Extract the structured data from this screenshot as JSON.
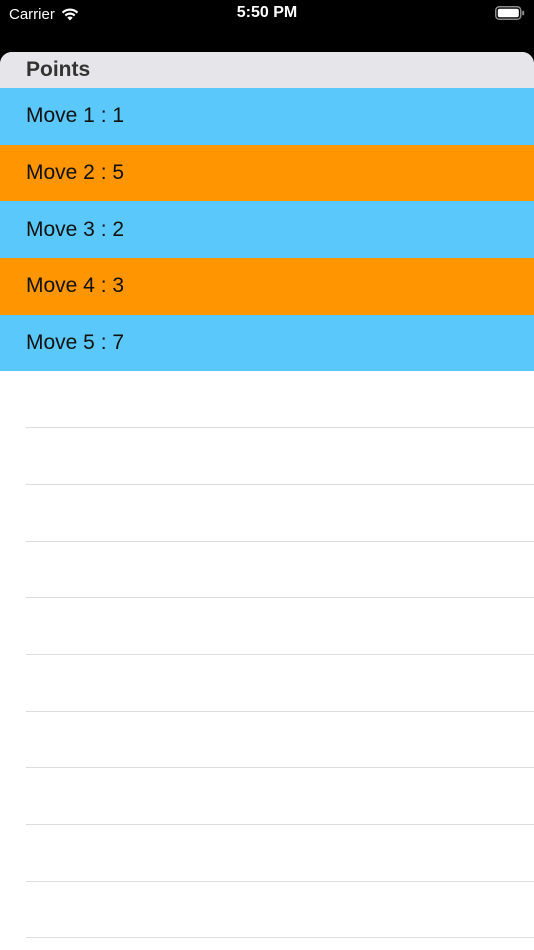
{
  "status_bar": {
    "carrier": "Carrier",
    "time": "5:50 PM"
  },
  "table": {
    "section_title": "Points",
    "row_colors": [
      "#5ac8fa",
      "#ff9500"
    ],
    "rows": [
      {
        "label": "Move 1 : 1",
        "color": "#5ac8fa"
      },
      {
        "label": "Move 2 : 5",
        "color": "#ff9500"
      },
      {
        "label": "Move 3 : 2",
        "color": "#5ac8fa"
      },
      {
        "label": "Move 4 : 3",
        "color": "#ff9500"
      },
      {
        "label": "Move 5 : 7",
        "color": "#5ac8fa"
      }
    ]
  }
}
